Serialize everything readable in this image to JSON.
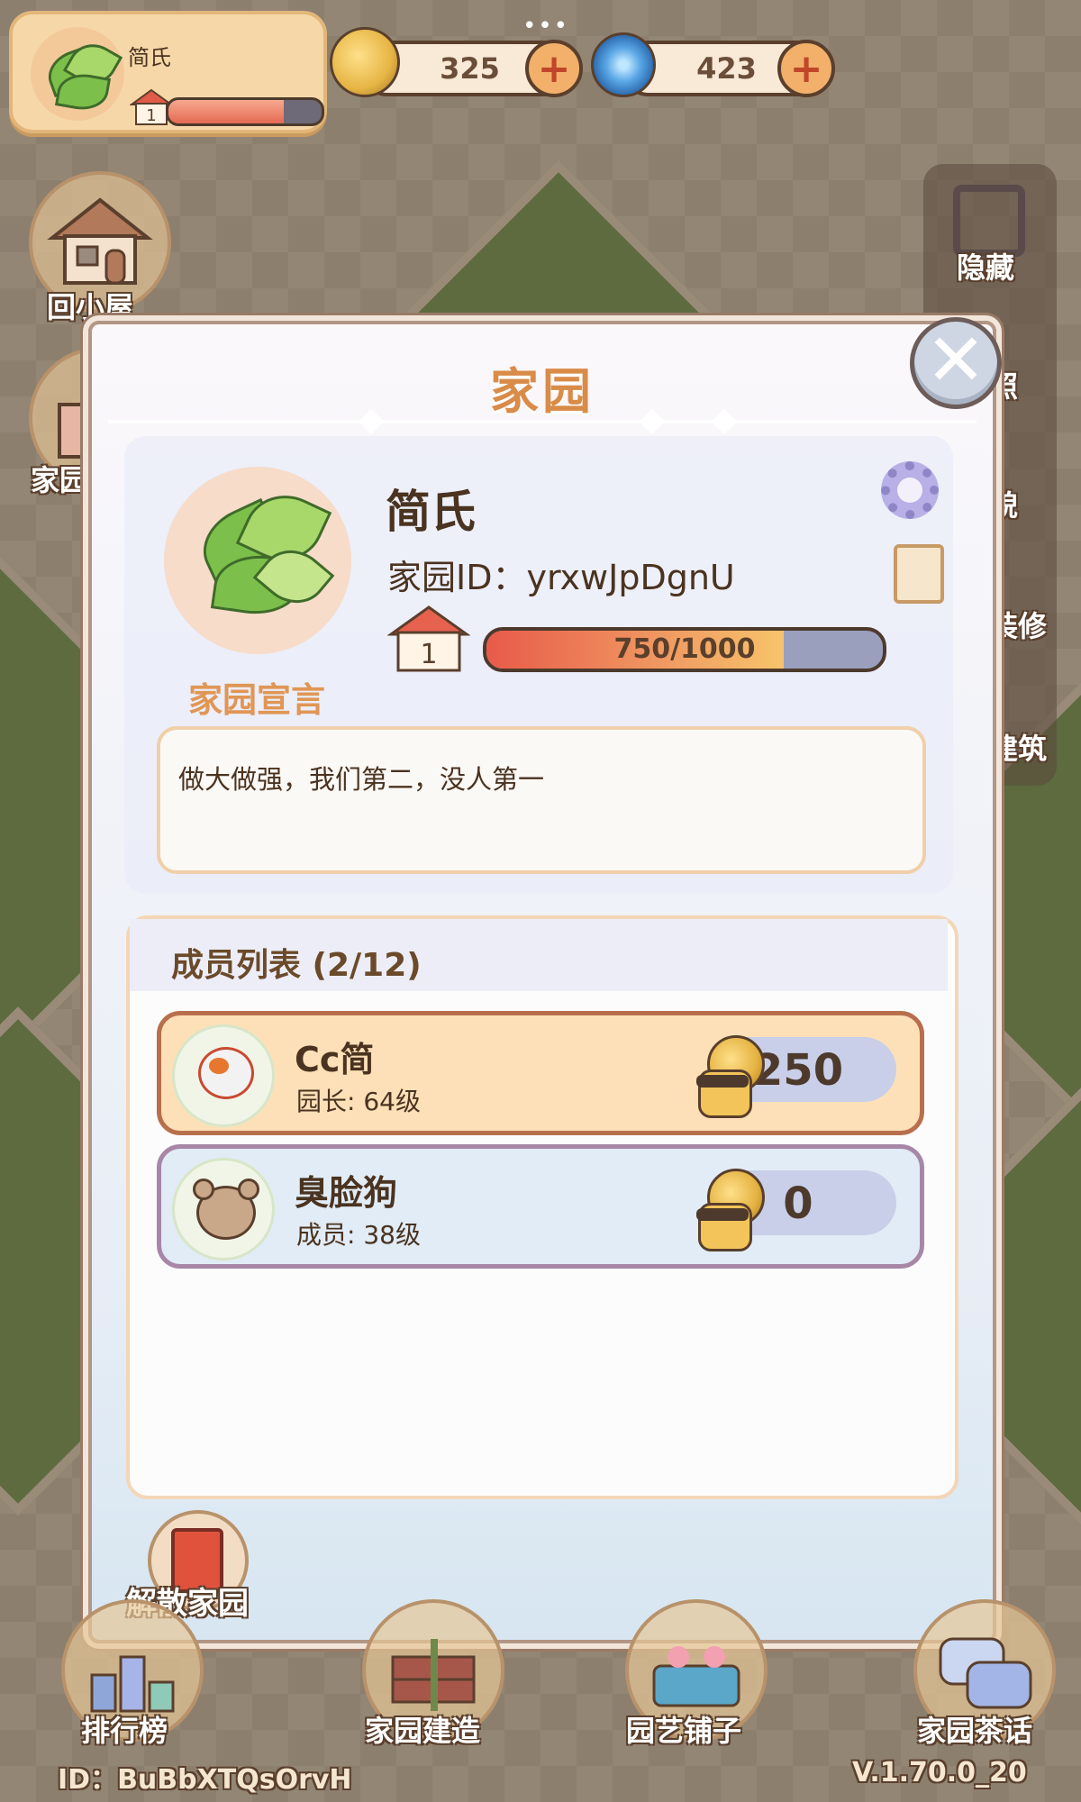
{
  "top_bar": {
    "profile_name": "简氏",
    "level": "1",
    "level_progress": 0.75,
    "currencies": [
      {
        "icon": "snail-coin-icon",
        "value": "325"
      },
      {
        "icon": "spiral-gem-icon",
        "value": "423"
      }
    ],
    "plus_symbol": "+",
    "menu_dots": "•••"
  },
  "left_menu": {
    "items": [
      {
        "label": "回小屋",
        "icon": "house-icon"
      },
      {
        "label": "家园",
        "icon": "gift-icon"
      }
    ]
  },
  "right_menu": {
    "items": [
      {
        "label": "隐藏",
        "icon": "hide-frame-icon"
      },
      {
        "label": "照",
        "icon": "camera-icon"
      },
      {
        "label": "貌",
        "icon": "appearance-icon"
      },
      {
        "label": "装修",
        "icon": "wrench-icon"
      },
      {
        "label": "建筑",
        "icon": "building-icon"
      }
    ]
  },
  "dialog": {
    "title": "家园",
    "close_symbol": "✕",
    "home_name": "简氏",
    "home_id_label": "家园ID：",
    "home_id": "yrxwJpDgnU",
    "level": "1",
    "exp_text": "750/1000",
    "exp_current": 750,
    "exp_max": 1000,
    "declaration_label": "家园宣言",
    "declaration_text": "做大做强，我们第二，没人第一",
    "members_title": "成员列表 (2/12)",
    "members": [
      {
        "name": "Cc简",
        "role": "园长: 64级",
        "score": "250",
        "type": "owner"
      },
      {
        "name": "臭脸狗",
        "role": "成员: 38级",
        "score": "0",
        "type": "member"
      }
    ],
    "disband_label": "解散家园"
  },
  "bottom_nav": {
    "items": [
      {
        "label": "排行榜",
        "icon": "ranking-icon"
      },
      {
        "label": "家园建造",
        "icon": "brick-trowel-icon"
      },
      {
        "label": "园艺铺子",
        "icon": "flower-basket-icon"
      },
      {
        "label": "家园茶话",
        "icon": "chat-bubbles-icon"
      }
    ]
  },
  "footer": {
    "player_id": "ID：BuBbXTQsOrvH",
    "version": "V.1.70.0_20"
  },
  "colors": {
    "title_orange": "#d98b48",
    "owner_row_bg": "#fde0b8",
    "member_row_bg": "#e1ecf6",
    "exp_fill": "#f09a62"
  }
}
